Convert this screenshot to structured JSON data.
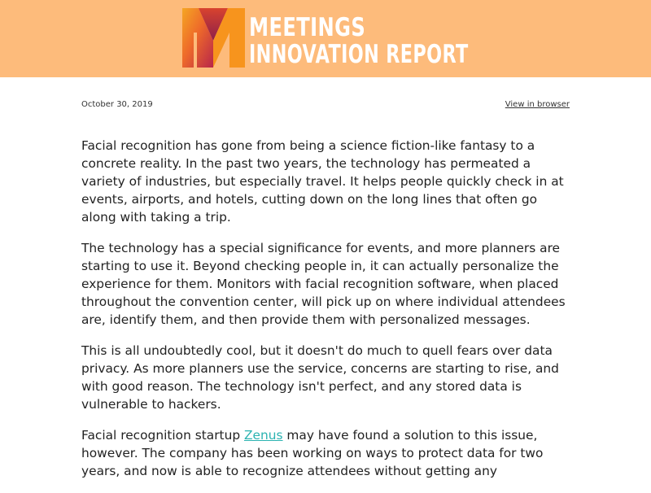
{
  "header": {
    "logo_line1": "MEETINGS",
    "logo_line2": "INNOVATION REPORT",
    "colors": {
      "banner": "#fdbb7b",
      "logo_gradient": [
        "#f5a623",
        "#e8532a",
        "#b8254a"
      ]
    }
  },
  "meta": {
    "date": "October 30, 2019",
    "view_in_browser": "View in browser"
  },
  "article": {
    "p1": "Facial recognition has gone from being a science fiction-like fantasy to a concrete reality. In the past two years, the technology has permeated a variety of industries, but especially travel. It helps people quickly check in at events, airports, and hotels, cutting down on the long lines that often go along with taking a trip.",
    "p2": "The technology has a special significance for events, and more planners are starting to use it. Beyond checking people in, it can actually personalize the experience for them. Monitors with facial recognition software, when placed throughout the convention center, will pick up on where individual attendees are, identify them, and then provide them with personalized messages.",
    "p3": "This is all undoubtedly cool, but it doesn't do much to quell fears over data privacy. As more planners use the service, concerns are starting to rise, and with good reason. The technology isn't perfect, and any stored data is vulnerable to hackers.",
    "p4_before": "Facial recognition startup ",
    "p4_link": "Zenus",
    "p4_after": " may have found a solution to this issue, however. The company has been working on ways to protect data for two years, and now is able to recognize attendees without getting any",
    "link_color": "#2bb3b1"
  }
}
